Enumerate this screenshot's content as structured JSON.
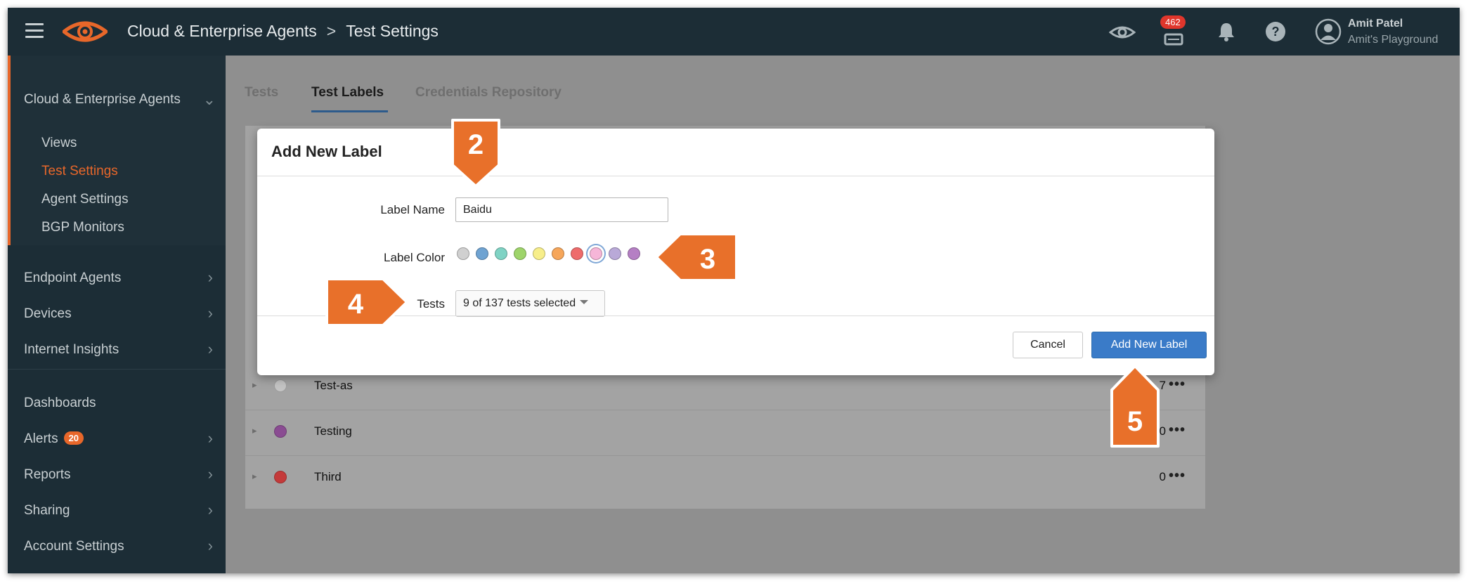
{
  "topbar": {
    "breadcrumb_parent": "Cloud & Enterprise Agents",
    "breadcrumb_separator": ">",
    "breadcrumb_current": "Test Settings",
    "notification_count": "462",
    "user_name": "Amit Patel",
    "user_org": "Amit's Playground",
    "icons": [
      "hamburger-icon",
      "eye-logo-icon",
      "eye-icon",
      "notifications-tray-icon",
      "bell-icon",
      "help-icon",
      "user-avatar-icon"
    ]
  },
  "sidebar": {
    "section_title": "Cloud & Enterprise Agents",
    "sub_items": [
      "Views",
      "Test Settings",
      "Agent Settings",
      "BGP Monitors"
    ],
    "active_sub_item": "Test Settings",
    "items": [
      "Endpoint Agents",
      "Devices",
      "Internet Insights",
      "Dashboards",
      "Alerts",
      "Reports",
      "Sharing",
      "Account Settings"
    ],
    "alerts_badge": "20",
    "accent_color": "#e8672a"
  },
  "main": {
    "tabs": [
      "Tests",
      "Test Labels",
      "Credentials Repository"
    ],
    "active_tab": "Test Labels",
    "rows": [
      {
        "name": "Test-as",
        "count": "7",
        "color": "#c4c4c4"
      },
      {
        "name": "Testing",
        "count": "0",
        "color": "#8a4c92"
      },
      {
        "name": "Third",
        "count": "0",
        "color": "#c43a3a"
      }
    ],
    "more_glyph": "•••"
  },
  "modal": {
    "title": "Add New Label",
    "label_name_label": "Label Name",
    "label_name_value": "Baidu",
    "label_color_label": "Label Color",
    "colors": [
      "#d0d0d0",
      "#6fa3d2",
      "#7fd3c4",
      "#9ed46a",
      "#f7ee8a",
      "#f6a65a",
      "#ee6b6b",
      "#f6b6d8",
      "#b9a9d8",
      "#b57fc4"
    ],
    "selected_color_index": 7,
    "tests_label": "Tests",
    "tests_value": "9 of 137 tests selected",
    "cancel_label": "Cancel",
    "submit_label": "Add New Label"
  },
  "callouts": [
    "2",
    "3",
    "4",
    "5"
  ],
  "callout_color": "#e8702a"
}
